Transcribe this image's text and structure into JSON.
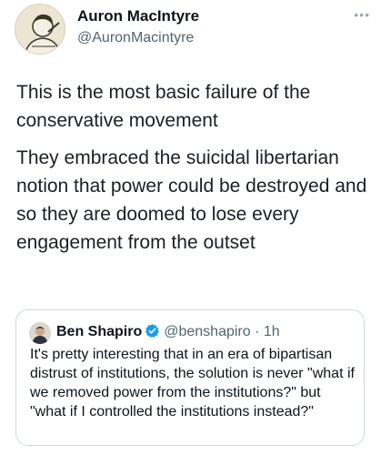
{
  "author": {
    "name": "Auron MacIntyre",
    "handle": "@AuronMacintyre"
  },
  "tweet": {
    "paragraphs": [
      "This is the most basic failure of the conservative movement",
      "They embraced the suicidal libertarian notion that power could be destroyed and so they are doomed to lose every engagement from the outset"
    ]
  },
  "quoted": {
    "name": "Ben Shapiro",
    "handle": "@benshapiro",
    "separator": "·",
    "time": "1h",
    "verified_color": "#1d9bf0",
    "text": "It's pretty interesting that in an era of bipartisan distrust of institutions, the solution is never \"what if we removed power from the institutions?\" but \"what if I controlled the institutions instead?\""
  },
  "icons": {
    "more": "more-dots-icon",
    "verified": "verified-badge-icon"
  }
}
